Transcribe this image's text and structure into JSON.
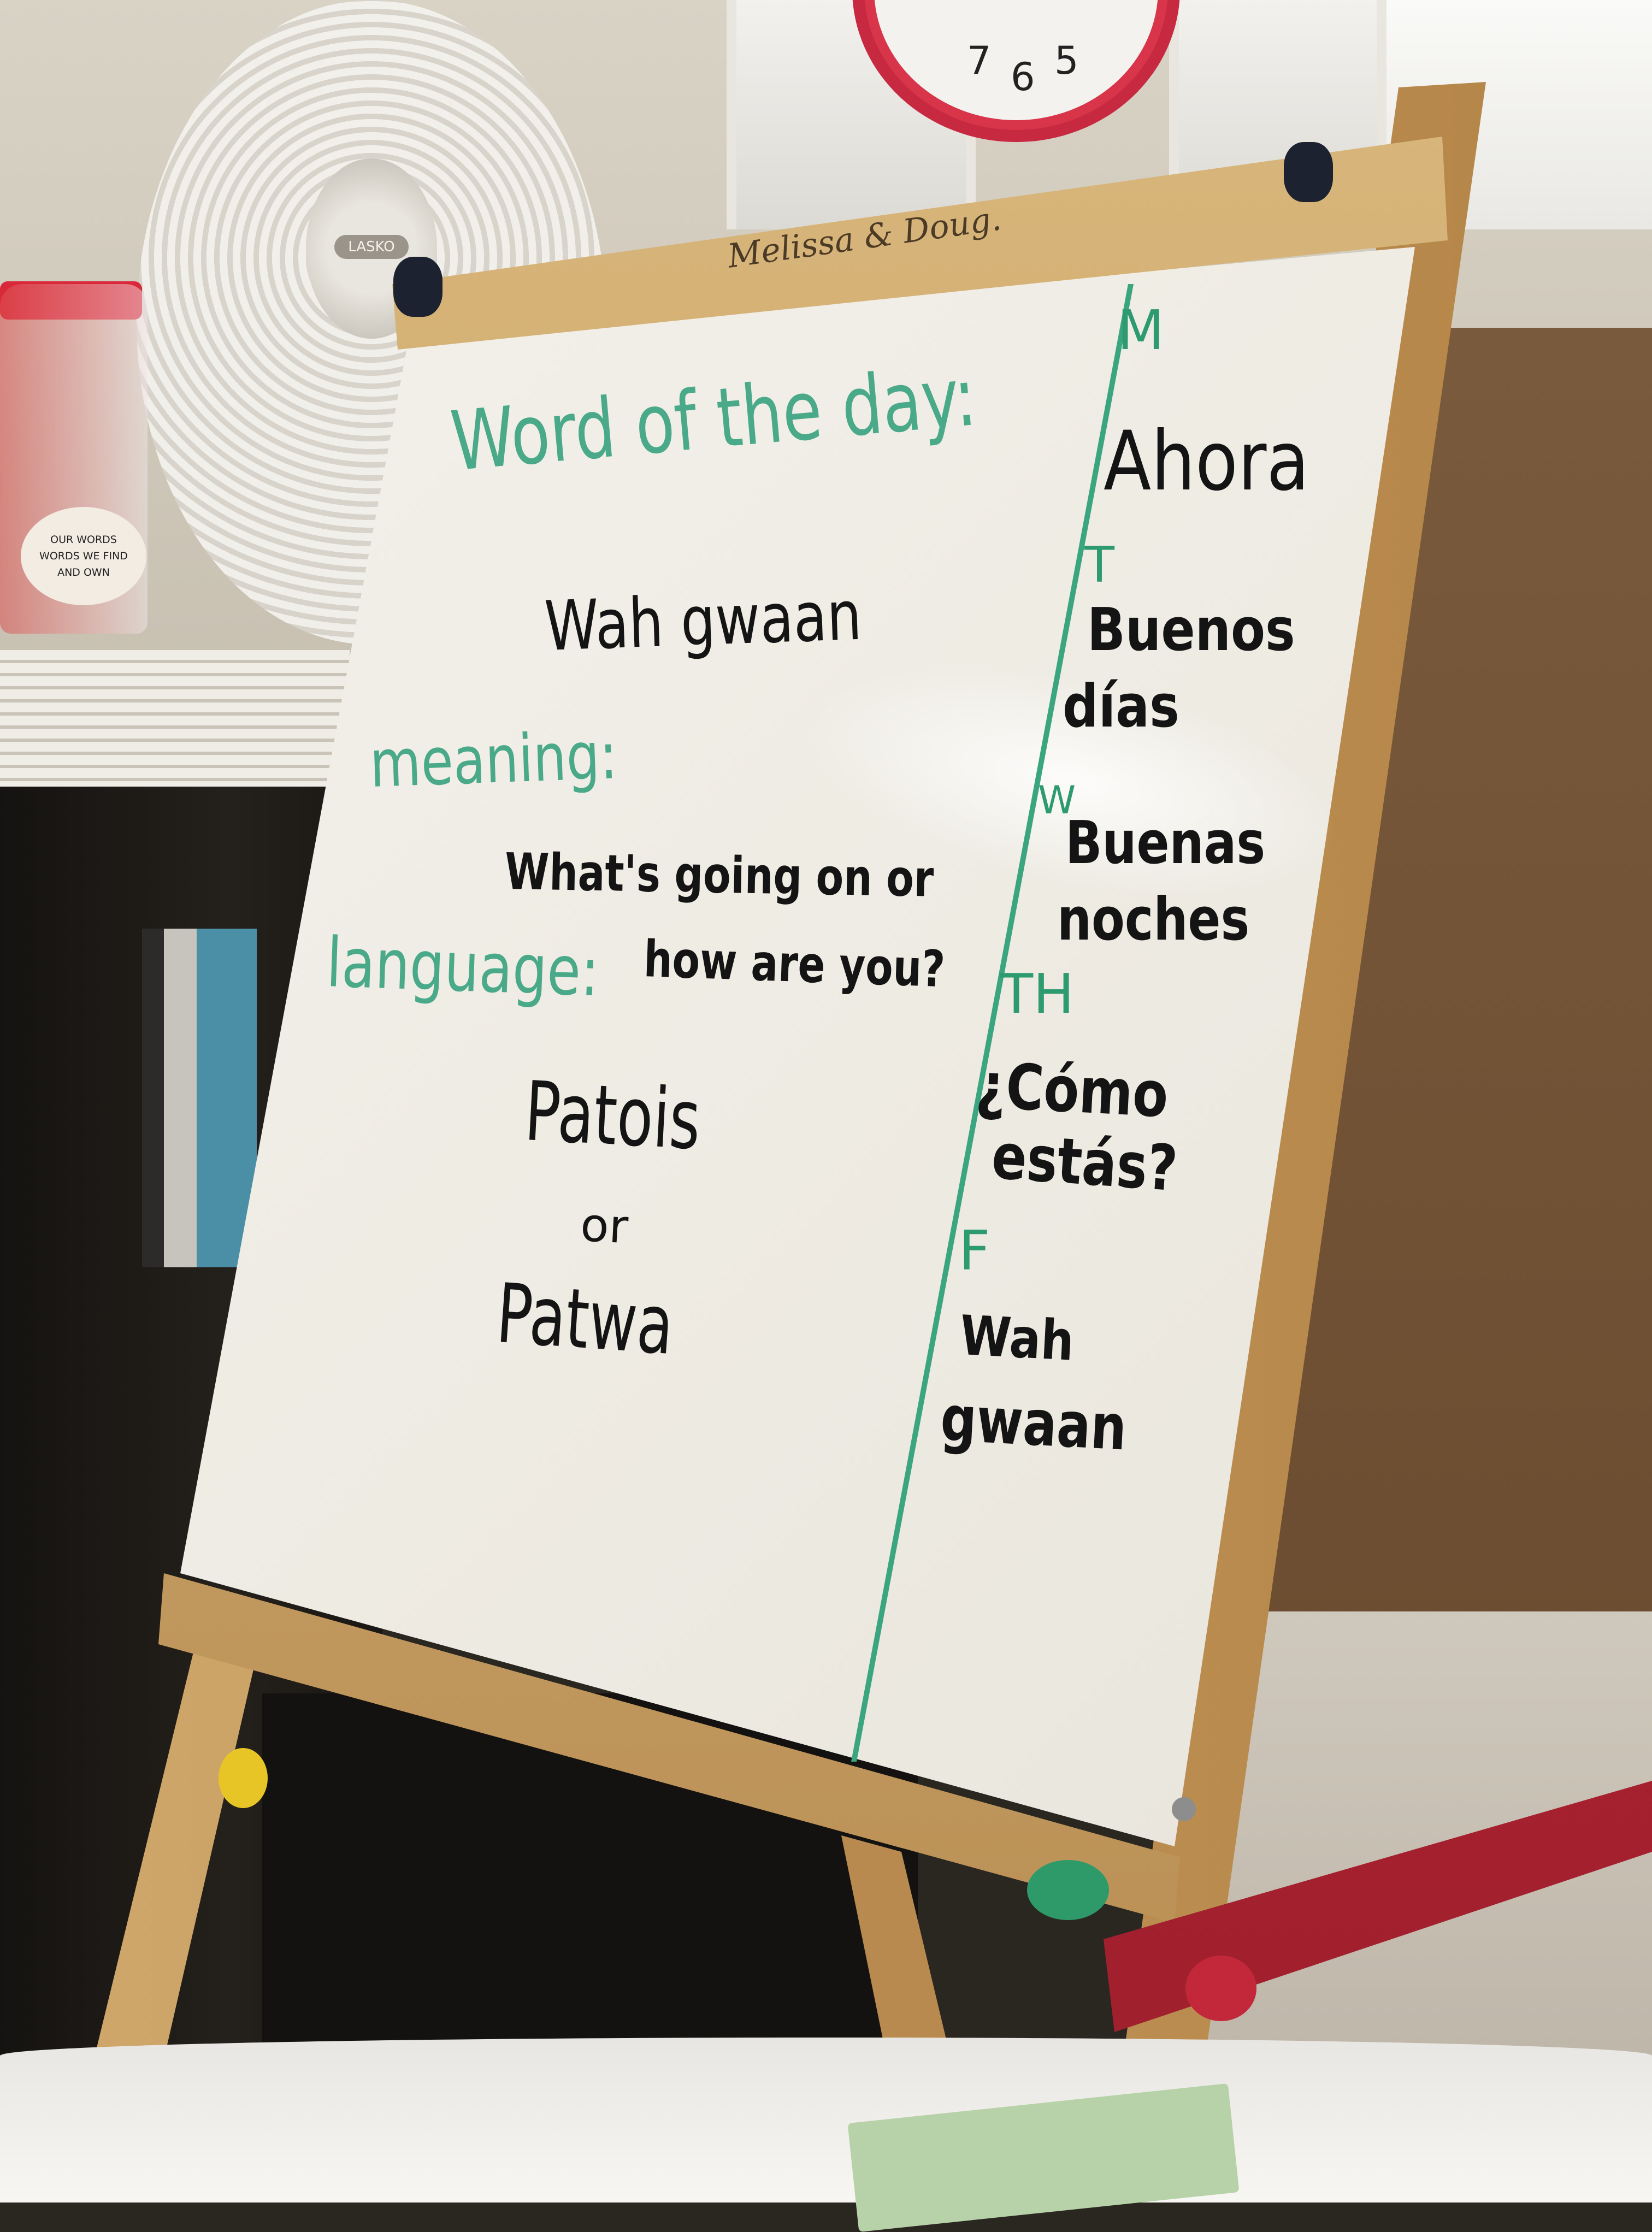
{
  "board": {
    "brand": "Melissa & Doug.",
    "word_of_day_label": "Word of the day:",
    "word": "Wah gwaan",
    "meaning_label": "meaning:",
    "meaning_line1": "What's going on or",
    "meaning_line2": "how are you?",
    "language_label": "language:",
    "language_1": "Patois",
    "language_or": "or",
    "language_2": "Patwa"
  },
  "week": [
    {
      "day": "M",
      "word_lines": [
        "Ahora"
      ]
    },
    {
      "day": "T",
      "word_lines": [
        "Buenos",
        "días"
      ]
    },
    {
      "day": "W",
      "word_lines": [
        "Buenas",
        "noches"
      ]
    },
    {
      "day": "TH",
      "word_lines": [
        "¿Cómo",
        "estás?"
      ]
    },
    {
      "day": "F",
      "word_lines": [
        "Wah",
        "gwaan"
      ]
    }
  ],
  "jar_label": {
    "line1": "OUR WORDS",
    "line2": "WORDS WE FIND",
    "line3": "AND OWN"
  },
  "fan_brand": "LASKO",
  "clock_numbers": [
    "7",
    "6",
    "5"
  ],
  "colors": {
    "marker_green": "#49a989",
    "marker_black": "#141414",
    "divider_green": "#3aa57e",
    "easel_wood": "#c89b59",
    "clock_red": "#d8344a"
  }
}
